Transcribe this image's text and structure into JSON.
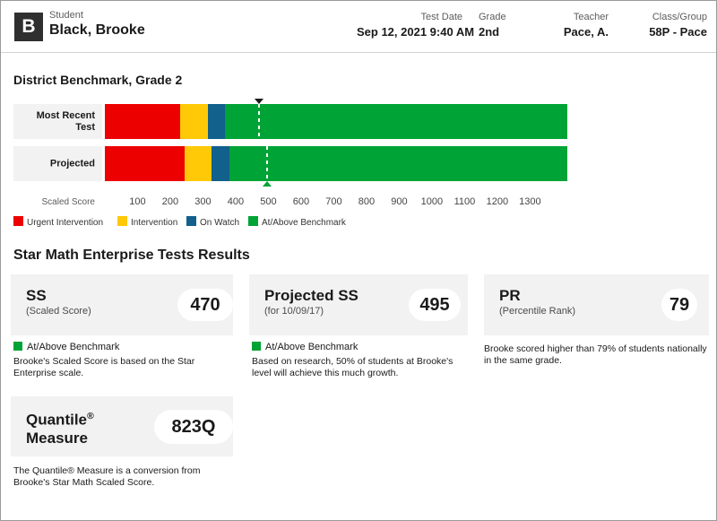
{
  "header": {
    "avatar_initial": "B",
    "student_label": "Student",
    "student_name": "Black, Brooke",
    "test_date_label": "Test Date",
    "test_date_value": "Sep 12, 2021 9:40 AM",
    "grade_label": "Grade",
    "grade_value": "2nd",
    "teacher_label": "Teacher",
    "teacher_value": "Pace, A.",
    "class_label": "Class/Group",
    "class_value": "58P - Pace"
  },
  "benchmark": {
    "title": "District Benchmark, Grade 2",
    "axis_title": "Scaled Score",
    "rows": [
      {
        "label": "Most Recent Test",
        "marker_value": 470,
        "marker_style": "down-black"
      },
      {
        "label": "Projected",
        "marker_value": 495,
        "marker_style": "up-green"
      }
    ],
    "legend": [
      {
        "label": "Urgent Intervention",
        "color": "#ED0000"
      },
      {
        "label": "Intervention",
        "color": "#FFC907"
      },
      {
        "label": "On Watch",
        "color": "#12608C"
      },
      {
        "label": "At/Above Benchmark",
        "color": "#00A335"
      }
    ]
  },
  "chart_data": {
    "type": "bar",
    "title": "District Benchmark, Grade 2",
    "xlabel": "Scaled Score",
    "ylabel": "",
    "grid": false,
    "legend_position": "bottom-left",
    "xlim": [
      0,
      1414
    ],
    "xticks": [
      100,
      200,
      300,
      400,
      500,
      600,
      700,
      800,
      900,
      1000,
      1100,
      1200,
      1300
    ],
    "categories": [
      "Most Recent Test",
      "Projected"
    ],
    "bands": [
      {
        "name": "Urgent Intervention",
        "color": "#ED0000"
      },
      {
        "name": "Intervention",
        "color": "#FFC907"
      },
      {
        "name": "On Watch",
        "color": "#12608C"
      },
      {
        "name": "At/Above Benchmark",
        "color": "#00A335"
      }
    ],
    "series": [
      {
        "name": "Most Recent Test",
        "band_breaks": [
          230,
          315,
          367,
          1414
        ],
        "marker_value": 470,
        "marker_band": "At/Above Benchmark"
      },
      {
        "name": "Projected",
        "band_breaks": [
          244,
          326,
          381,
          1414
        ],
        "marker_value": 495,
        "marker_band": "At/Above Benchmark"
      }
    ]
  },
  "results": {
    "title": "Star Math Enterprise Tests Results",
    "cards": [
      {
        "title": "SS",
        "subtitle": "(Scaled Score)",
        "value": "470",
        "benchmark_tag": "At/Above Benchmark",
        "benchmark_color": "#00A335",
        "note": "Brooke's Scaled Score is based on the Star Enterprise scale."
      },
      {
        "title": "Projected SS",
        "subtitle": "(for 10/09/17)",
        "value": "495",
        "benchmark_tag": "At/Above Benchmark",
        "benchmark_color": "#00A335",
        "note": "Based on research, 50% of students at Brooke's level will achieve this much growth."
      },
      {
        "title": "PR",
        "subtitle": "(Percentile Rank)",
        "value": "79",
        "benchmark_tag": "",
        "benchmark_color": "",
        "note": "Brooke scored higher than 79% of students nationally in the same grade."
      }
    ],
    "quantile": {
      "title_line1": "Quantile",
      "title_line2": "Measure",
      "value": "823Q",
      "note": "The Quantile® Measure is a conversion from Brooke's Star Math Scaled Score."
    }
  }
}
